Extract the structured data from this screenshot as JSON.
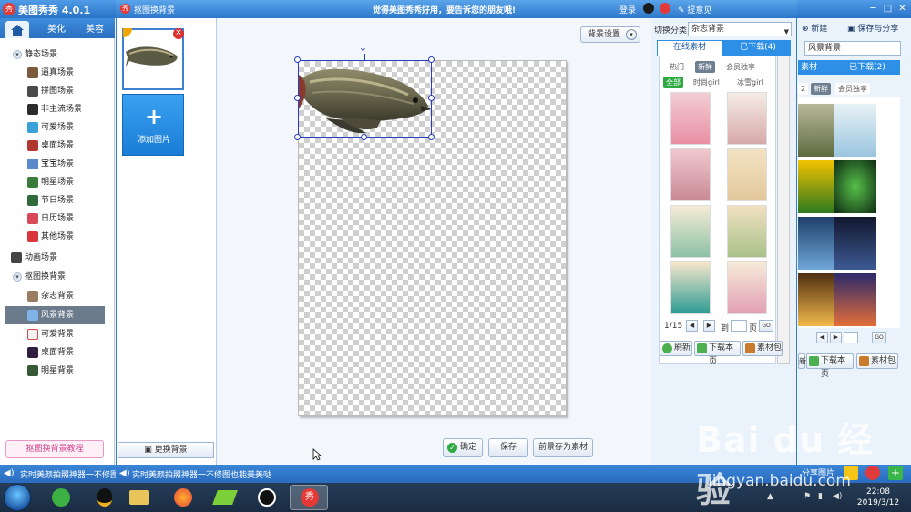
{
  "main_window": {
    "title": "美图秀秀 4.0.1",
    "tabs": [
      "美化",
      "美容"
    ],
    "sidebar": [
      {
        "label": "静态场景",
        "level": 0
      },
      {
        "label": "逼真场景",
        "level": 1
      },
      {
        "label": "拼图场景",
        "level": 1
      },
      {
        "label": "非主流场景",
        "level": 1
      },
      {
        "label": "可爱场景",
        "level": 1
      },
      {
        "label": "桌面场景",
        "level": 1
      },
      {
        "label": "宝宝场景",
        "level": 1
      },
      {
        "label": "明星场景",
        "level": 1
      },
      {
        "label": "节日场景",
        "level": 1
      },
      {
        "label": "日历场景",
        "level": 1
      },
      {
        "label": "其他场景",
        "level": 1
      },
      {
        "label": "动画场景",
        "level": 0
      },
      {
        "label": "抠图换背景",
        "level": 0
      },
      {
        "label": "杂志背景",
        "level": 1
      },
      {
        "label": "风景背景",
        "level": 1,
        "selected": true
      },
      {
        "label": "可爱背景",
        "level": 1
      },
      {
        "label": "桌面背景",
        "level": 1
      },
      {
        "label": "明星背景",
        "level": 1
      }
    ],
    "tutorial_button": "抠图换背景教程",
    "status_text": "实时美颜拍照神器一不修图",
    "right_panel": {
      "new_button": "新建",
      "save_share_button": "保存与分享",
      "category_value": "风景背景",
      "tabs": [
        "素材",
        "已下载(2)"
      ],
      "chips": [
        "新鲜",
        "会员独享"
      ],
      "download_page_button": "下载本页",
      "pack_button": "素材包",
      "refresh_partial": "新",
      "share_label": "分享图片"
    }
  },
  "dialog": {
    "title": "抠图换背景",
    "banner": "觉得美图秀秀好用，要告诉您的朋友哦!",
    "login": "登录",
    "feedback": "提意见",
    "add_image": "添加图片",
    "change_background": "更换背景",
    "background_settings": "背景设置",
    "confirm_button": "确定",
    "save_button": "保存",
    "save_foreground_button": "前景存为素材",
    "status_text": "实时美颜拍照神器一不修图也能美美哒"
  },
  "materials": {
    "category_label": "切换分类",
    "category_value": "杂志背景",
    "tabs": [
      {
        "label": "在线素材",
        "selected": true
      },
      {
        "label": "已下载(4)",
        "selected": false
      }
    ],
    "filter_chips": [
      {
        "label": "热门",
        "selected": false
      },
      {
        "label": "新鲜",
        "selected": true
      },
      {
        "label": "会员独享",
        "selected": false
      }
    ],
    "style_chips": [
      {
        "label": "全部",
        "selected": true
      },
      {
        "label": "时尚girl",
        "selected": false
      },
      {
        "label": "冰雪girl",
        "selected": false
      }
    ],
    "page_indicator": "1/15",
    "page_prefix": "到",
    "page_suffix": "页",
    "go_button": "GO",
    "refresh_button": "刷新",
    "download_page_button": "下载本页",
    "pack_button": "素材包"
  },
  "taskbar": {
    "time": "22:08",
    "date": "2019/3/12"
  },
  "watermark": {
    "brand": "Bai du 经验",
    "url": "jingyan.baidu.com"
  },
  "colors": {
    "title_blue": "#2e78cc",
    "selection_blue": "#2a3fbf",
    "tab_blue": "#2d8fe6",
    "chip_green": "#2eaa43",
    "delete_red": "#d9322f"
  }
}
